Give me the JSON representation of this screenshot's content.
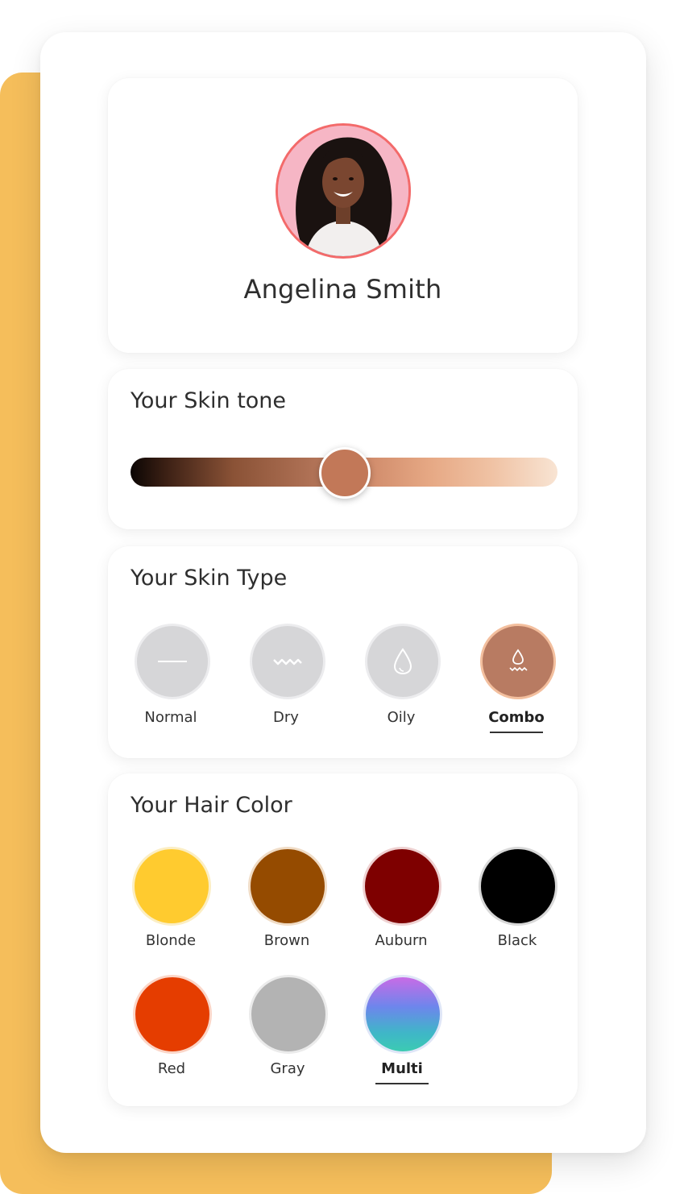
{
  "profile": {
    "name": "Angelina Smith"
  },
  "skin_tone": {
    "title": "Your Skin tone",
    "value_fraction": 0.5,
    "selected_color": "#c27858"
  },
  "skin_type": {
    "title": "Your Skin Type",
    "options": [
      {
        "label": "Normal",
        "icon": "dash-icon",
        "selected": false
      },
      {
        "label": "Dry",
        "icon": "wave-icon",
        "selected": false
      },
      {
        "label": "Oily",
        "icon": "drop-icon",
        "selected": false
      },
      {
        "label": "Combo",
        "icon": "drop-wave-icon",
        "selected": true
      }
    ]
  },
  "hair_color": {
    "title": "Your Hair Color",
    "options": [
      {
        "label": "Blonde",
        "color": "#ffcb2f",
        "selected": false
      },
      {
        "label": "Brown",
        "color": "#954b00",
        "selected": false
      },
      {
        "label": "Auburn",
        "color": "#7e0000",
        "selected": false
      },
      {
        "label": "Black",
        "color": "#000000",
        "selected": false
      },
      {
        "label": "Red",
        "color": "#e53d00",
        "selected": false
      },
      {
        "label": "Gray",
        "color": "#b3b3b3",
        "selected": false
      },
      {
        "label": "Multi",
        "color": "gradient",
        "selected": true
      }
    ]
  },
  "colors": {
    "accent_backdrop": "#f5be5b",
    "avatar_ring": "#f36a6a",
    "selected_skin": "#b87b62"
  }
}
